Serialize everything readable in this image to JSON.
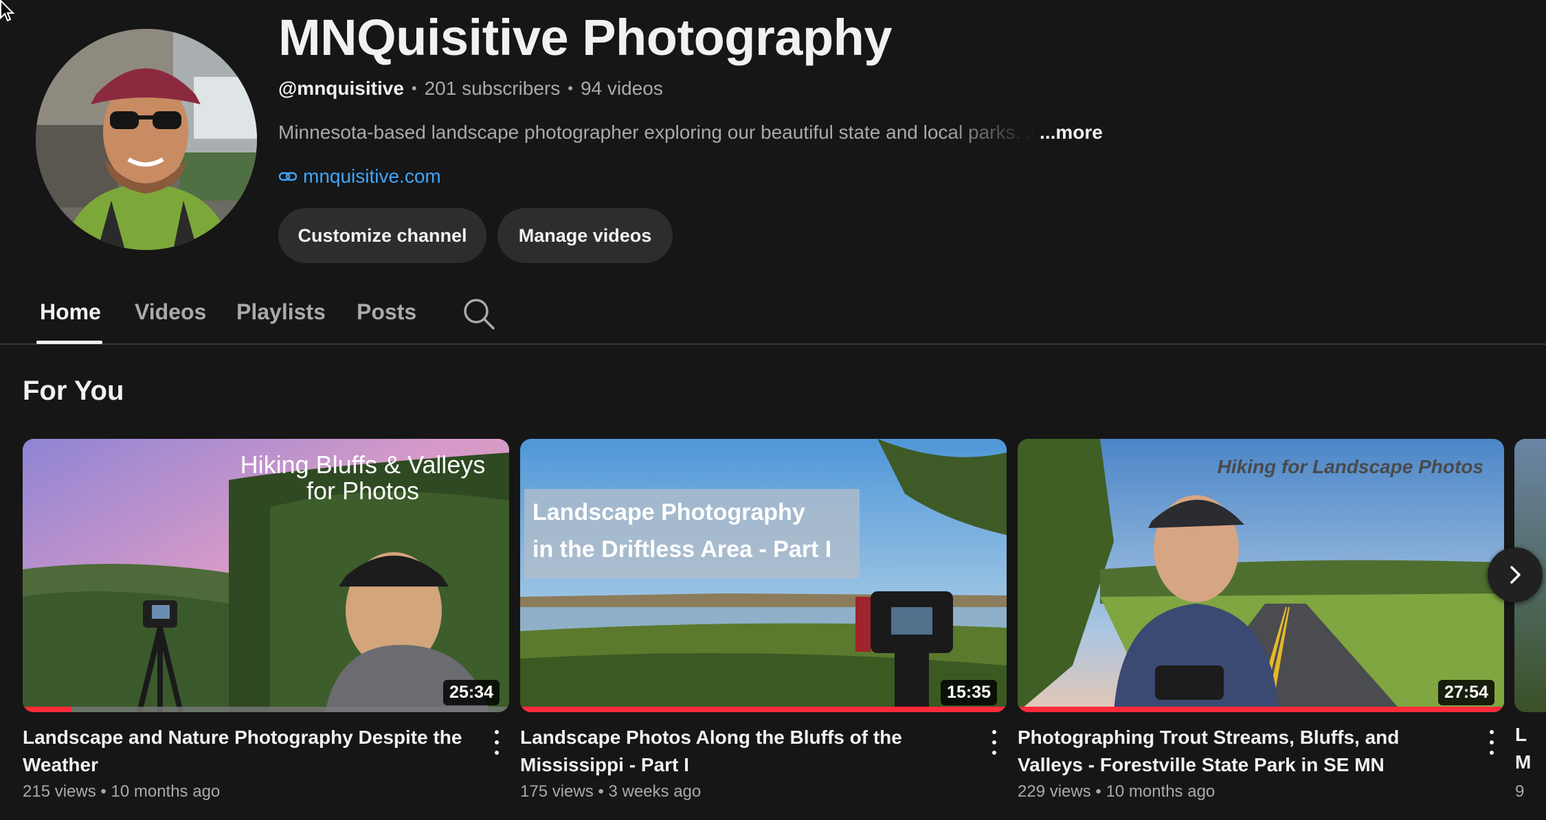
{
  "channel": {
    "name": "MNQuisitive Photography",
    "handle": "@mnquisitive",
    "subscribers": "201 subscribers",
    "video_count": "94 videos",
    "description": "Minnesota-based landscape photographer exploring our beautiful state and local parks. J",
    "more_label": "...more",
    "link": "mnquisitive.com"
  },
  "buttons": {
    "customize": "Customize channel",
    "manage": "Manage videos"
  },
  "tabs": [
    {
      "label": "Home",
      "active": true
    },
    {
      "label": "Videos",
      "active": false
    },
    {
      "label": "Playlists",
      "active": false
    },
    {
      "label": "Posts",
      "active": false
    }
  ],
  "section": {
    "title": "For You"
  },
  "videos": [
    {
      "title": "Landscape and Nature Photography Despite the Weather",
      "views": "215 views",
      "age": "10 months ago",
      "duration": "25:34",
      "watched_fraction": 0.1,
      "thumb_caption_1": "Hiking Bluffs & Valleys",
      "thumb_caption_2": "for Photos"
    },
    {
      "title": "Landscape Photos Along the Bluffs of the Mississippi - Part I",
      "views": "175 views",
      "age": "3 weeks ago",
      "duration": "15:35",
      "watched_fraction": 1.0,
      "thumb_caption_1": "Landscape Photography",
      "thumb_caption_2": "in the Driftless Area - Part I"
    },
    {
      "title": "Photographing Trout Streams, Bluffs, and Valleys - Forestville State Park in SE MN",
      "views": "229 views",
      "age": "10 months ago",
      "duration": "27:54",
      "watched_fraction": 1.0,
      "thumb_caption_1": "Hiking for Landscape Photos"
    }
  ],
  "peek": {
    "line1": "L",
    "line2": "M",
    "line3": "9"
  },
  "icons": {
    "link": "link-icon",
    "search": "search-icon",
    "next": "chevron-right-icon",
    "more": "more-vert-icon",
    "cursor": "mouse-pointer-icon"
  },
  "colors": {
    "background": "#161616",
    "link": "#3ea6ff",
    "progress": "#ff2a3a",
    "button": "#2d2d2d"
  }
}
